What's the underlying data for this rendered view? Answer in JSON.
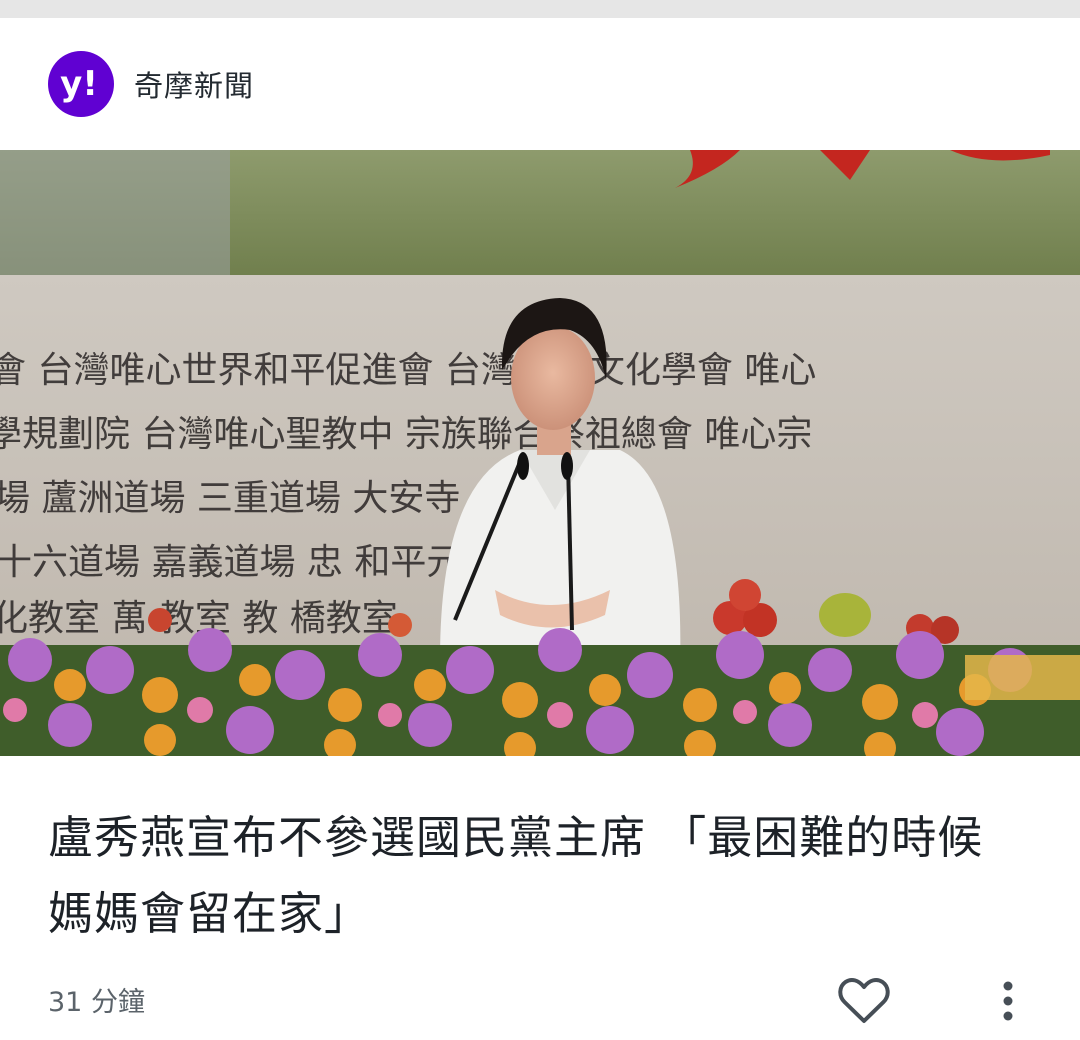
{
  "source": {
    "name": "奇摩新聞",
    "logo_text": "y!",
    "logo_color": "#6001d2"
  },
  "article": {
    "headline": "盧秀燕宣布不參選國民黨主席 「最困難的時候 媽媽會留在家」",
    "timestamp": "31 分鐘",
    "image_alt": "盧秀燕於台上講台前發言，背景為寫有道場與團體名稱的布幕，前方擺滿花卉",
    "image_backdrop_text": [
      "會 台灣唯心世界和平促進會 台灣鬼谷文化學會 唯心",
      "學規劃院 台灣唯心聖教中 宗族聯合祭祖總會 唯心宗",
      "場 蘆洲道場 三重道場 大安寺 大凡寺 三",
      "十六道場 嘉義道場 忠 和平元點臺中道場",
      "化教室 萬 教室 教 橋教室"
    ]
  },
  "actions": {
    "like_icon": "heart-outline-icon",
    "more_icon": "vertical-dots-icon"
  },
  "colors": {
    "headline": "#1d2228",
    "meta": "#5b636a",
    "icon": "#464e56"
  }
}
